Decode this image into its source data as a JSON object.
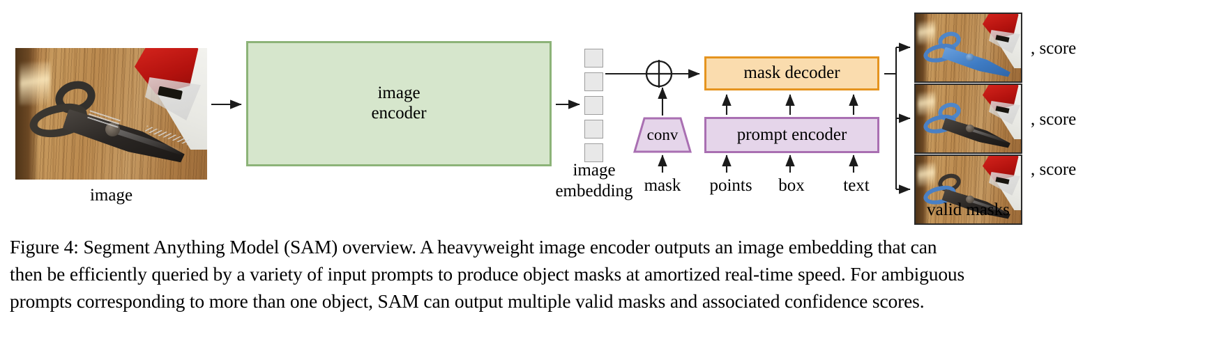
{
  "figure": {
    "caption_lines": [
      "Figure 4: Segment Anything Model (SAM) overview.  A heavyweight image encoder outputs an image embedding that can",
      "then be efficiently queried by a variety of input prompts to produce object masks at amortized real-time speed. For ambiguous",
      "prompts corresponding to more than one object, SAM can output multiple valid masks and associated confidence scores."
    ],
    "caption_number": "Figure 4:"
  },
  "diagram": {
    "input": {
      "label": "image",
      "alt": "photograph of dark Fiskars Paper Edgers Deckle scissors on a wooden table beside a red Scotch tape dispenser"
    },
    "image_encoder": {
      "line1": "image",
      "line2": "encoder",
      "fill": "#d6e6cc",
      "stroke": "#8cb378"
    },
    "image_embedding": {
      "line1": "image",
      "line2": "embedding",
      "cell_count": 5,
      "cell_fill": "#e8e8e8",
      "cell_stroke": "#9d9d9d"
    },
    "sum_operator": {
      "symbol": "+",
      "name": "element-wise sum"
    },
    "conv": {
      "label": "conv",
      "fill": "#e5d5ea",
      "stroke": "#a96fb2"
    },
    "prompt_encoder": {
      "label": "prompt encoder",
      "fill": "#e5d5ea",
      "stroke": "#a96fb2"
    },
    "mask_decoder": {
      "label": "mask decoder",
      "fill": "#fadcae",
      "stroke": "#e5941f"
    },
    "prompt_inputs": [
      {
        "label": "mask"
      },
      {
        "label": "points"
      },
      {
        "label": "box"
      },
      {
        "label": "text"
      }
    ],
    "outputs": {
      "group_label": "valid masks",
      "masks": [
        {
          "score_label": ", score",
          "alt": "whole scissors highlighted in blue"
        },
        {
          "score_label": ", score",
          "alt": "scissors handles highlighted in blue"
        },
        {
          "score_label": ", score",
          "alt": "single lower scissor handle highlighted in blue"
        }
      ]
    }
  }
}
